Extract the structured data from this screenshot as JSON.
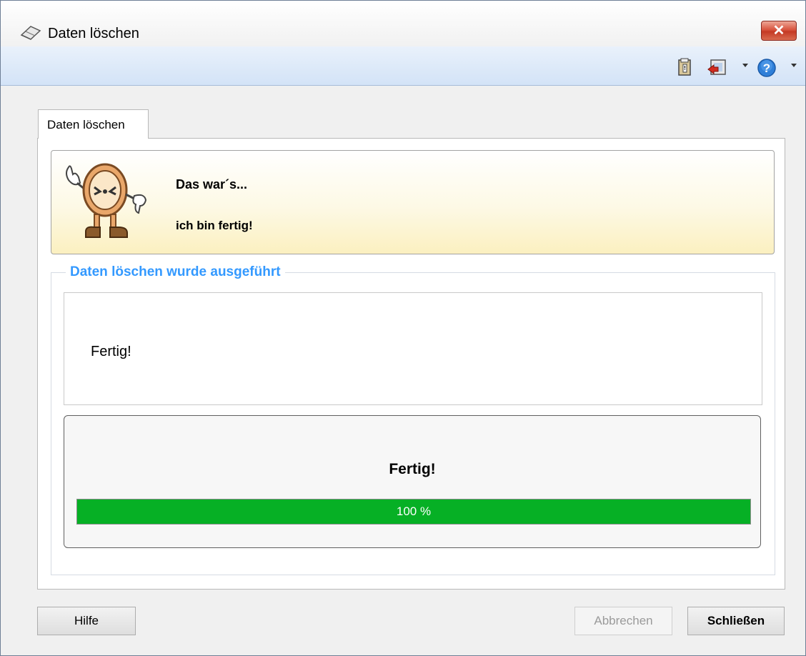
{
  "window": {
    "title": "Daten löschen",
    "close_label": "✕"
  },
  "toolbar": {
    "icons": [
      "clipboard-icon",
      "exit-icon",
      "help-icon"
    ]
  },
  "tabs": [
    {
      "label": "Daten löschen",
      "active": true
    }
  ],
  "banner": {
    "line1": "Das war´s...",
    "line2": "ich bin fertig!"
  },
  "group": {
    "title": "Daten löschen wurde ausgeführt",
    "status_text": "Fertig!",
    "progress_title": "Fertig!",
    "progress_percent": 100,
    "progress_label": "100 %"
  },
  "buttons": {
    "help": "Hilfe",
    "cancel": "Abbrechen",
    "close": "Schließen"
  },
  "colors": {
    "progress_fill": "#06b025",
    "group_title": "#3399ff"
  }
}
